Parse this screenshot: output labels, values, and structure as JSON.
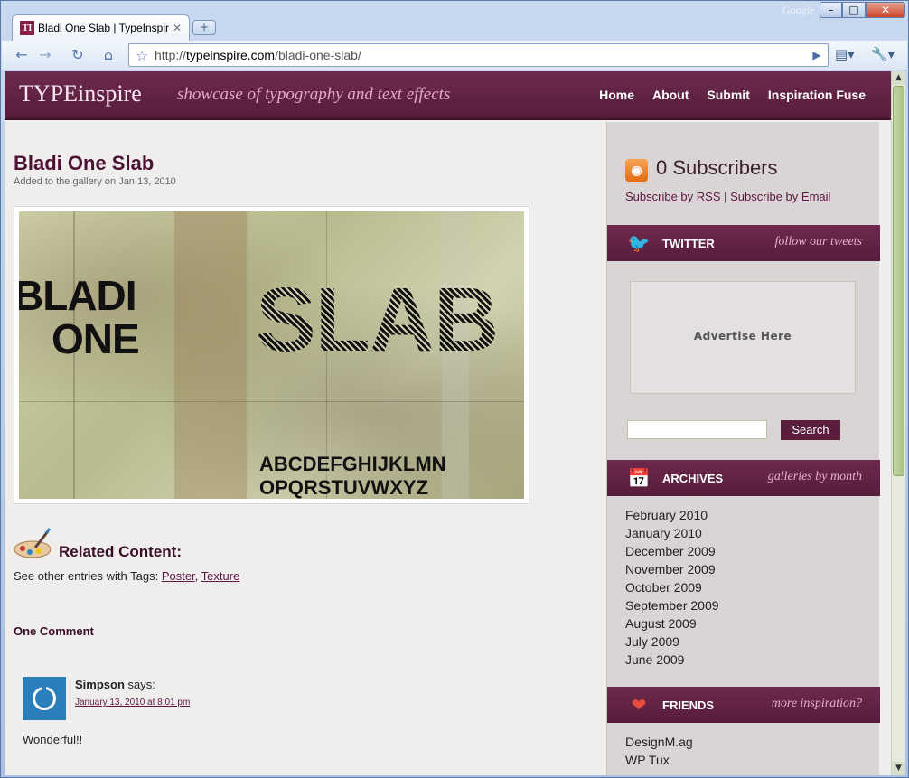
{
  "browser": {
    "tab_title": "Bladi One Slab | TypeInspire",
    "tab_favicon": "TI",
    "google_label": "Google",
    "url_host": "typeinspire.com",
    "url_prefix": "http://",
    "url_path": "/bladi-one-slab/"
  },
  "site": {
    "logo": "TYPEinspire",
    "tagline": "showcase of typography and text effects",
    "nav": [
      "Home",
      "About",
      "Submit",
      "Inspiration Fuse"
    ]
  },
  "post": {
    "title": "Bladi One Slab",
    "date_line": "Added to the gallery on Jan 13, 2010",
    "poster_text": {
      "bladi": "BLADI",
      "one": "ONE",
      "slab": "SLAB",
      "alpha1": "ABCDEFGHIJKLMN",
      "alpha2": "OPQRSTUVWXYZ"
    },
    "related_heading": "Related Content:",
    "tags_prefix": "See other entries with Tags:",
    "tags": [
      "Poster",
      "Texture"
    ],
    "comments_heading": "One Comment",
    "comment": {
      "author": "Simpson",
      "says": "says:",
      "date": "January 13, 2010 at 8:01 pm",
      "text": "Wonderful!!"
    }
  },
  "sidebar": {
    "subscribers": "0 Subscribers",
    "subscribe_rss": "Subscribe by RSS",
    "subscribe_sep": "|",
    "subscribe_email": "Subscribe by Email",
    "twitter": {
      "title": "TWITTER",
      "subtitle": "follow our tweets"
    },
    "ad_text": "Advertise Here",
    "search_button": "Search",
    "archives": {
      "title": "ARCHIVES",
      "subtitle": "galleries by month",
      "items": [
        "February 2010",
        "January 2010",
        "December 2009",
        "November 2009",
        "October 2009",
        "September 2009",
        "August 2009",
        "July 2009",
        "June 2009"
      ]
    },
    "friends": {
      "title": "FRIENDS",
      "subtitle": "more inspiration?",
      "items": [
        "DesignM.ag",
        "WP Tux"
      ]
    }
  },
  "colors": {
    "brand": "#5a1d3d",
    "link": "#5e1742",
    "rss": "#e16c12"
  }
}
